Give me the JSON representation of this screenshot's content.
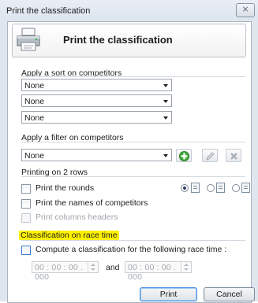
{
  "window": {
    "title": "Print the classification",
    "close_label": "⨯"
  },
  "header": {
    "title": "Print the classification",
    "icon": "printer-icon"
  },
  "sort": {
    "label": "Apply a sort on competitors",
    "combos": [
      "None",
      "None",
      "None"
    ]
  },
  "filter": {
    "label": "Apply a filter on competitors",
    "combo": "None",
    "buttons": [
      "add-icon",
      "edit-icon",
      "delete-icon"
    ]
  },
  "two_rows": {
    "label": "Printing on 2 rows",
    "options": [
      {
        "label": "Print the rounds",
        "checked": false,
        "enabled": true
      },
      {
        "label": "Print the names of competitors",
        "checked": false,
        "enabled": true
      },
      {
        "label": "Print columns headers",
        "checked": false,
        "enabled": false
      }
    ],
    "layout_radios": [
      {
        "selected": true,
        "icon": "layout-icon"
      },
      {
        "selected": false,
        "icon": "layout-icon"
      },
      {
        "selected": false,
        "icon": "layout-icon"
      }
    ]
  },
  "race_time": {
    "label": "Classification on race time",
    "highlight_color": "#fff200",
    "compute_label": "Compute a classification for the following race time :",
    "compute_checked": false,
    "from_value": "00 : 00 : 00 . 000",
    "and_label": "and",
    "to_value": "00 : 00 : 00 . 000"
  },
  "actions": {
    "print_label": "Print",
    "cancel_label": "Cancel"
  }
}
